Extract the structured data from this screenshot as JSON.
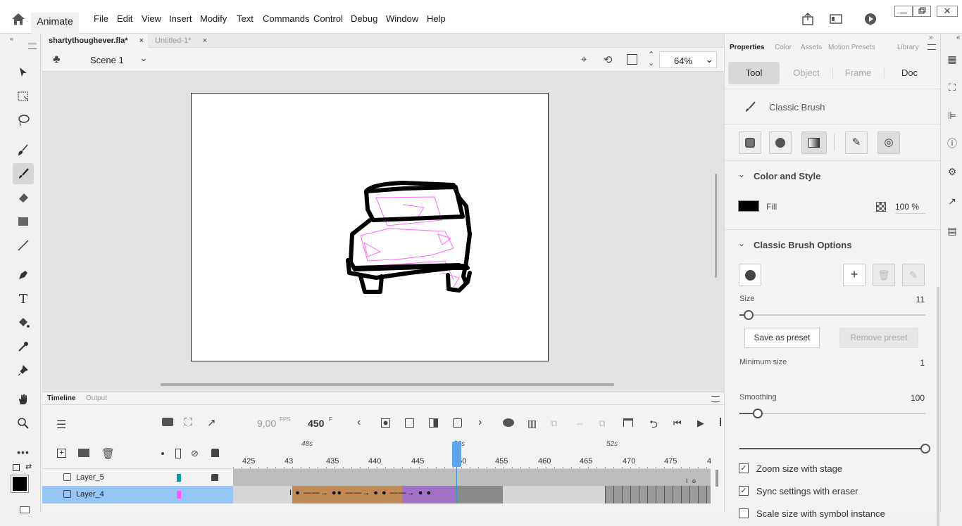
{
  "app": {
    "name": "Animate"
  },
  "menu": [
    "File",
    "Edit",
    "View",
    "Insert",
    "Modify",
    "Text",
    "Commands",
    "Control",
    "Debug",
    "Window",
    "Help"
  ],
  "tabs": [
    {
      "label": "shartythoughever.fla*",
      "active": true
    },
    {
      "label": "Untitled-1*",
      "active": false
    }
  ],
  "scene": {
    "label": "Scene 1",
    "zoom": "64%"
  },
  "timeline": {
    "tabs": [
      "Timeline",
      "Output"
    ],
    "fps": "9,00",
    "fps_unit": "FPS",
    "frame": "450",
    "frame_unit": "F",
    "sec_labels": [
      "48s",
      "50s",
      "52s"
    ],
    "ruler": [
      "425",
      "43",
      "435",
      "440",
      "445",
      "450",
      "455",
      "460",
      "465",
      "470",
      "475",
      "4"
    ],
    "layers": [
      {
        "name": "Layer_5",
        "color": "#00a0a0",
        "locked": true,
        "selected": false
      },
      {
        "name": "Layer_4",
        "color": "#ff55ff",
        "locked": false,
        "selected": true
      }
    ]
  },
  "properties": {
    "tabs": [
      "Properties",
      "Color",
      "Assets",
      "Motion Presets",
      "Library"
    ],
    "subtabs": [
      "Tool",
      "Object",
      "Frame",
      "Doc"
    ],
    "tool_name": "Classic Brush",
    "color_style": {
      "title": "Color and Style",
      "fill_label": "Fill",
      "fill_color": "#000000",
      "alpha": "100 %"
    },
    "brush_options": {
      "title": "Classic Brush Options",
      "size_label": "Size",
      "size_value": "11",
      "size_fraction": 0.05,
      "save_preset": "Save as preset",
      "remove_preset": "Remove preset",
      "min_size_label": "Minimum size",
      "min_size_value": "1",
      "min_size_fraction": 0.1,
      "smoothing_label": "Smoothing",
      "smoothing_value": "100",
      "smoothing_fraction": 1.0,
      "checkboxes": [
        {
          "label": "Zoom size with stage",
          "checked": true
        },
        {
          "label": "Sync settings with eraser",
          "checked": true
        },
        {
          "label": "Scale size with symbol instance",
          "checked": false
        }
      ]
    }
  }
}
